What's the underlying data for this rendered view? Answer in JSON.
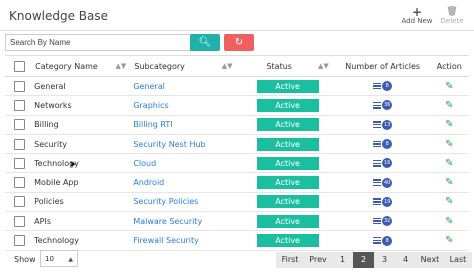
{
  "header": {
    "title": "Knowledge Base",
    "add_label": "Add New",
    "delete_label": "Delete"
  },
  "search": {
    "placeholder": "Search By Name",
    "search_icon": "search-icon",
    "reset_icon": "refresh-icon"
  },
  "table": {
    "columns": [
      "Category Name",
      "Subcategory",
      "Status",
      "Number of Articles",
      "Action"
    ],
    "rows": [
      {
        "category": "General",
        "subcategory": "General",
        "status": "Active",
        "articles": "8"
      },
      {
        "category": "Networks",
        "subcategory": "Graphics",
        "status": "Active",
        "articles": "36"
      },
      {
        "category": "Billing",
        "subcategory": "Billing RTI",
        "status": "Active",
        "articles": "13"
      },
      {
        "category": "Security",
        "subcategory": "Security Nest Hub",
        "status": "Active",
        "articles": "8"
      },
      {
        "category": "Technology",
        "subcategory": "Cloud",
        "status": "Active",
        "articles": "16"
      },
      {
        "category": "Mobile App",
        "subcategory": "Android",
        "status": "Active",
        "articles": "40"
      },
      {
        "category": "Policies",
        "subcategory": "Security Policies",
        "status": "Active",
        "articles": "19"
      },
      {
        "category": "APIs",
        "subcategory": "Malware Security",
        "status": "Active",
        "articles": "32"
      },
      {
        "category": "Technology",
        "subcategory": "Firewall Security",
        "status": "Active",
        "articles": "8"
      }
    ]
  },
  "footer": {
    "show_label": "Show",
    "page_size": "10",
    "pagination": [
      "First",
      "Prev",
      "1",
      "2",
      "3",
      "4",
      "Next",
      "Last"
    ],
    "current_page": "2"
  },
  "colors": {
    "status_active": "#1bbf9f",
    "link": "#2a7fd3",
    "search_btn": "#20b2aa",
    "reset_btn": "#ef5f5f"
  }
}
